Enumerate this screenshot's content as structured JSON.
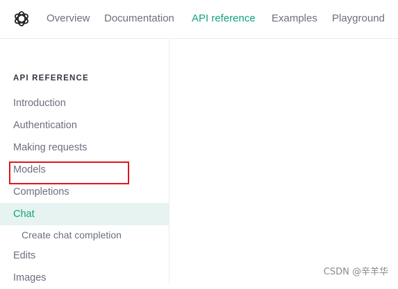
{
  "nav": {
    "items": [
      {
        "label": "Overview",
        "active": false
      },
      {
        "label": "Documentation",
        "active": false
      },
      {
        "label": "API reference",
        "active": true
      },
      {
        "label": "Examples",
        "active": false
      },
      {
        "label": "Playground",
        "active": false
      }
    ]
  },
  "sidebar": {
    "heading": "API REFERENCE",
    "items": [
      {
        "label": "Introduction"
      },
      {
        "label": "Authentication"
      },
      {
        "label": "Making requests"
      },
      {
        "label": "Models"
      },
      {
        "label": "Completions"
      },
      {
        "label": "Chat",
        "active": true
      },
      {
        "label": "Create chat completion",
        "sub": true
      },
      {
        "label": "Edits"
      },
      {
        "label": "Images"
      }
    ]
  },
  "watermark": "CSDN @辛羊华",
  "colors": {
    "accent": "#10a37f",
    "active_bg": "#e6f3f0",
    "annotation": "#e0141c"
  }
}
